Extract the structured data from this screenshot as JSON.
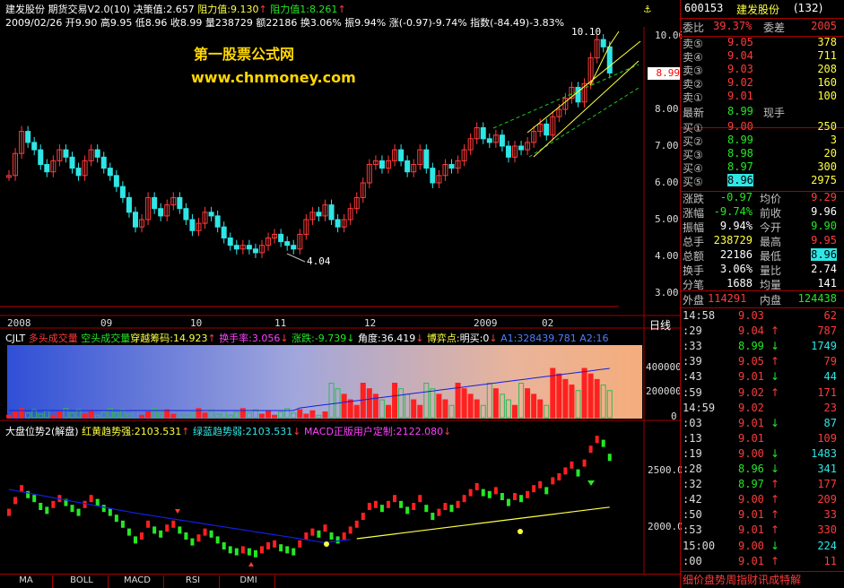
{
  "top_line": {
    "stock": "建发股份",
    "indicator": "期货交易V2.0(10)",
    "decision": "决策值:2.657",
    "resist": "阻力值:9.130",
    "support": "阻力值1:8.261"
  },
  "info_line": "2009/02/26 开9.90 高9.95 低8.96 收8.99 量238729 额22186 换3.06% 振9.94% 涨(-0.97)-9.74% 指数(-84.49)-3.83%",
  "watermark": {
    "line1": "第一股票公式网",
    "line2": "www.chnmoney.com"
  },
  "price_axis": [
    "10.00",
    "9.00",
    "8.00",
    "7.00",
    "6.00",
    "5.00",
    "4.00",
    "3.00"
  ],
  "price_marker": "8.99",
  "annot_high": "10.10",
  "annot_low": "4.04",
  "date_labels": [
    "2008",
    "09",
    "10",
    "11",
    "12",
    "2009",
    "02"
  ],
  "period_label": "日线",
  "vol_header": {
    "name": "CJLT",
    "duo": "多头成交量",
    "kong": "空头成交量",
    "chuan": "穿越筹码:14.923",
    "turn": "换手率:3.056",
    "chg": "涨跌:-9.739",
    "angle": "角度:36.419",
    "boyi": "博弈点:",
    "mingmai": "明买:0",
    "a1": "A1:328439.781",
    "a2": "A2:16"
  },
  "vol_axis": [
    "400000",
    "200000",
    "0"
  ],
  "trend_header": {
    "name": "大盘位势2(解盘)",
    "red": "红黄趋势强:2103.531",
    "green": "绿蓝趋势弱:2103.531",
    "macd": "MACD正版用户定制:2122.080"
  },
  "trend_axis": [
    "2500.0",
    "2000.0"
  ],
  "tabs": [
    "MA",
    "BOLL",
    "MACD",
    "RSI",
    "DMI"
  ],
  "quote": {
    "code": "600153",
    "name": "建发股份",
    "num": "(132)",
    "weibi_label": "委比",
    "weibi": "39.37%",
    "weicha_label": "委差",
    "weicha": "2005",
    "sell": [
      {
        "label": "卖⑤",
        "price": "9.05",
        "vol": "378"
      },
      {
        "label": "卖④",
        "price": "9.04",
        "vol": "711"
      },
      {
        "label": "卖③",
        "price": "9.03",
        "vol": "208"
      },
      {
        "label": "卖②",
        "price": "9.02",
        "vol": "160"
      },
      {
        "label": "卖①",
        "price": "9.01",
        "vol": "100"
      }
    ],
    "latest_label": "最新",
    "latest": "8.99",
    "xianshou": "现手",
    "buy": [
      {
        "label": "买①",
        "price": "9.00",
        "vol": "250"
      },
      {
        "label": "买②",
        "price": "8.99",
        "vol": "3"
      },
      {
        "label": "买③",
        "price": "8.98",
        "vol": "20"
      },
      {
        "label": "买④",
        "price": "8.97",
        "vol": "300"
      },
      {
        "label": "买⑤",
        "price": "8.96",
        "vol": "2975"
      }
    ],
    "stats": [
      {
        "l1": "涨跌",
        "v1": "-0.97",
        "l2": "均价",
        "v2": "9.29"
      },
      {
        "l1": "涨幅",
        "v1": "-9.74%",
        "l2": "前收",
        "v2": "9.96"
      },
      {
        "l1": "振幅",
        "v1": "9.94%",
        "l2": "今开",
        "v2": "9.90"
      },
      {
        "l1": "总手",
        "v1": "238729",
        "l2": "最高",
        "v2": "9.95"
      },
      {
        "l1": "总额",
        "v1": "22186",
        "l2": "最低",
        "v2": "8.96"
      },
      {
        "l1": "换手",
        "v1": "3.06%",
        "l2": "量比",
        "v2": "2.74"
      },
      {
        "l1": "分笔",
        "v1": "1688",
        "l2": "均量",
        "v2": "141"
      }
    ],
    "waipan_label": "外盘",
    "waipan": "114291",
    "neipan_label": "内盘",
    "neipan": "124438"
  },
  "ticks": [
    {
      "t": "14:58",
      "p": "9.03",
      "a": "",
      "v": "62"
    },
    {
      "t": ":29",
      "p": "9.04",
      "a": "↑",
      "v": "787"
    },
    {
      "t": ":33",
      "p": "8.99",
      "a": "↓",
      "v": "1749"
    },
    {
      "t": ":39",
      "p": "9.05",
      "a": "↑",
      "v": "79"
    },
    {
      "t": ":43",
      "p": "9.01",
      "a": "↓",
      "v": "44"
    },
    {
      "t": ":59",
      "p": "9.02",
      "a": "↑",
      "v": "171"
    },
    {
      "t": "14:59",
      "p": "9.02",
      "a": "",
      "v": "23"
    },
    {
      "t": ":03",
      "p": "9.01",
      "a": "↓",
      "v": "87"
    },
    {
      "t": ":13",
      "p": "9.01",
      "a": "",
      "v": "109"
    },
    {
      "t": ":19",
      "p": "9.00",
      "a": "↓",
      "v": "1483"
    },
    {
      "t": ":28",
      "p": "8.96",
      "a": "↓",
      "v": "341"
    },
    {
      "t": ":32",
      "p": "8.97",
      "a": "↑",
      "v": "177"
    },
    {
      "t": ":42",
      "p": "9.00",
      "a": "↑",
      "v": "209"
    },
    {
      "t": ":50",
      "p": "9.01",
      "a": "↑",
      "v": "33"
    },
    {
      "t": ":53",
      "p": "9.01",
      "a": "↑",
      "v": "330"
    },
    {
      "t": "15:00",
      "p": "9.00",
      "a": "↓",
      "v": "224"
    },
    {
      "t": ":00",
      "p": "9.01",
      "a": "↑",
      "v": "11"
    }
  ],
  "bottom_tabs": [
    "细",
    "价",
    "盘",
    "势",
    "周",
    "指",
    "财",
    "讯",
    "成",
    "特",
    "解"
  ],
  "colors": {
    "up": "#ff3b3b",
    "down": "#25e825",
    "yellow": "#ffff40",
    "cyan": "#2fe6e6",
    "grid": "#a00000"
  }
}
